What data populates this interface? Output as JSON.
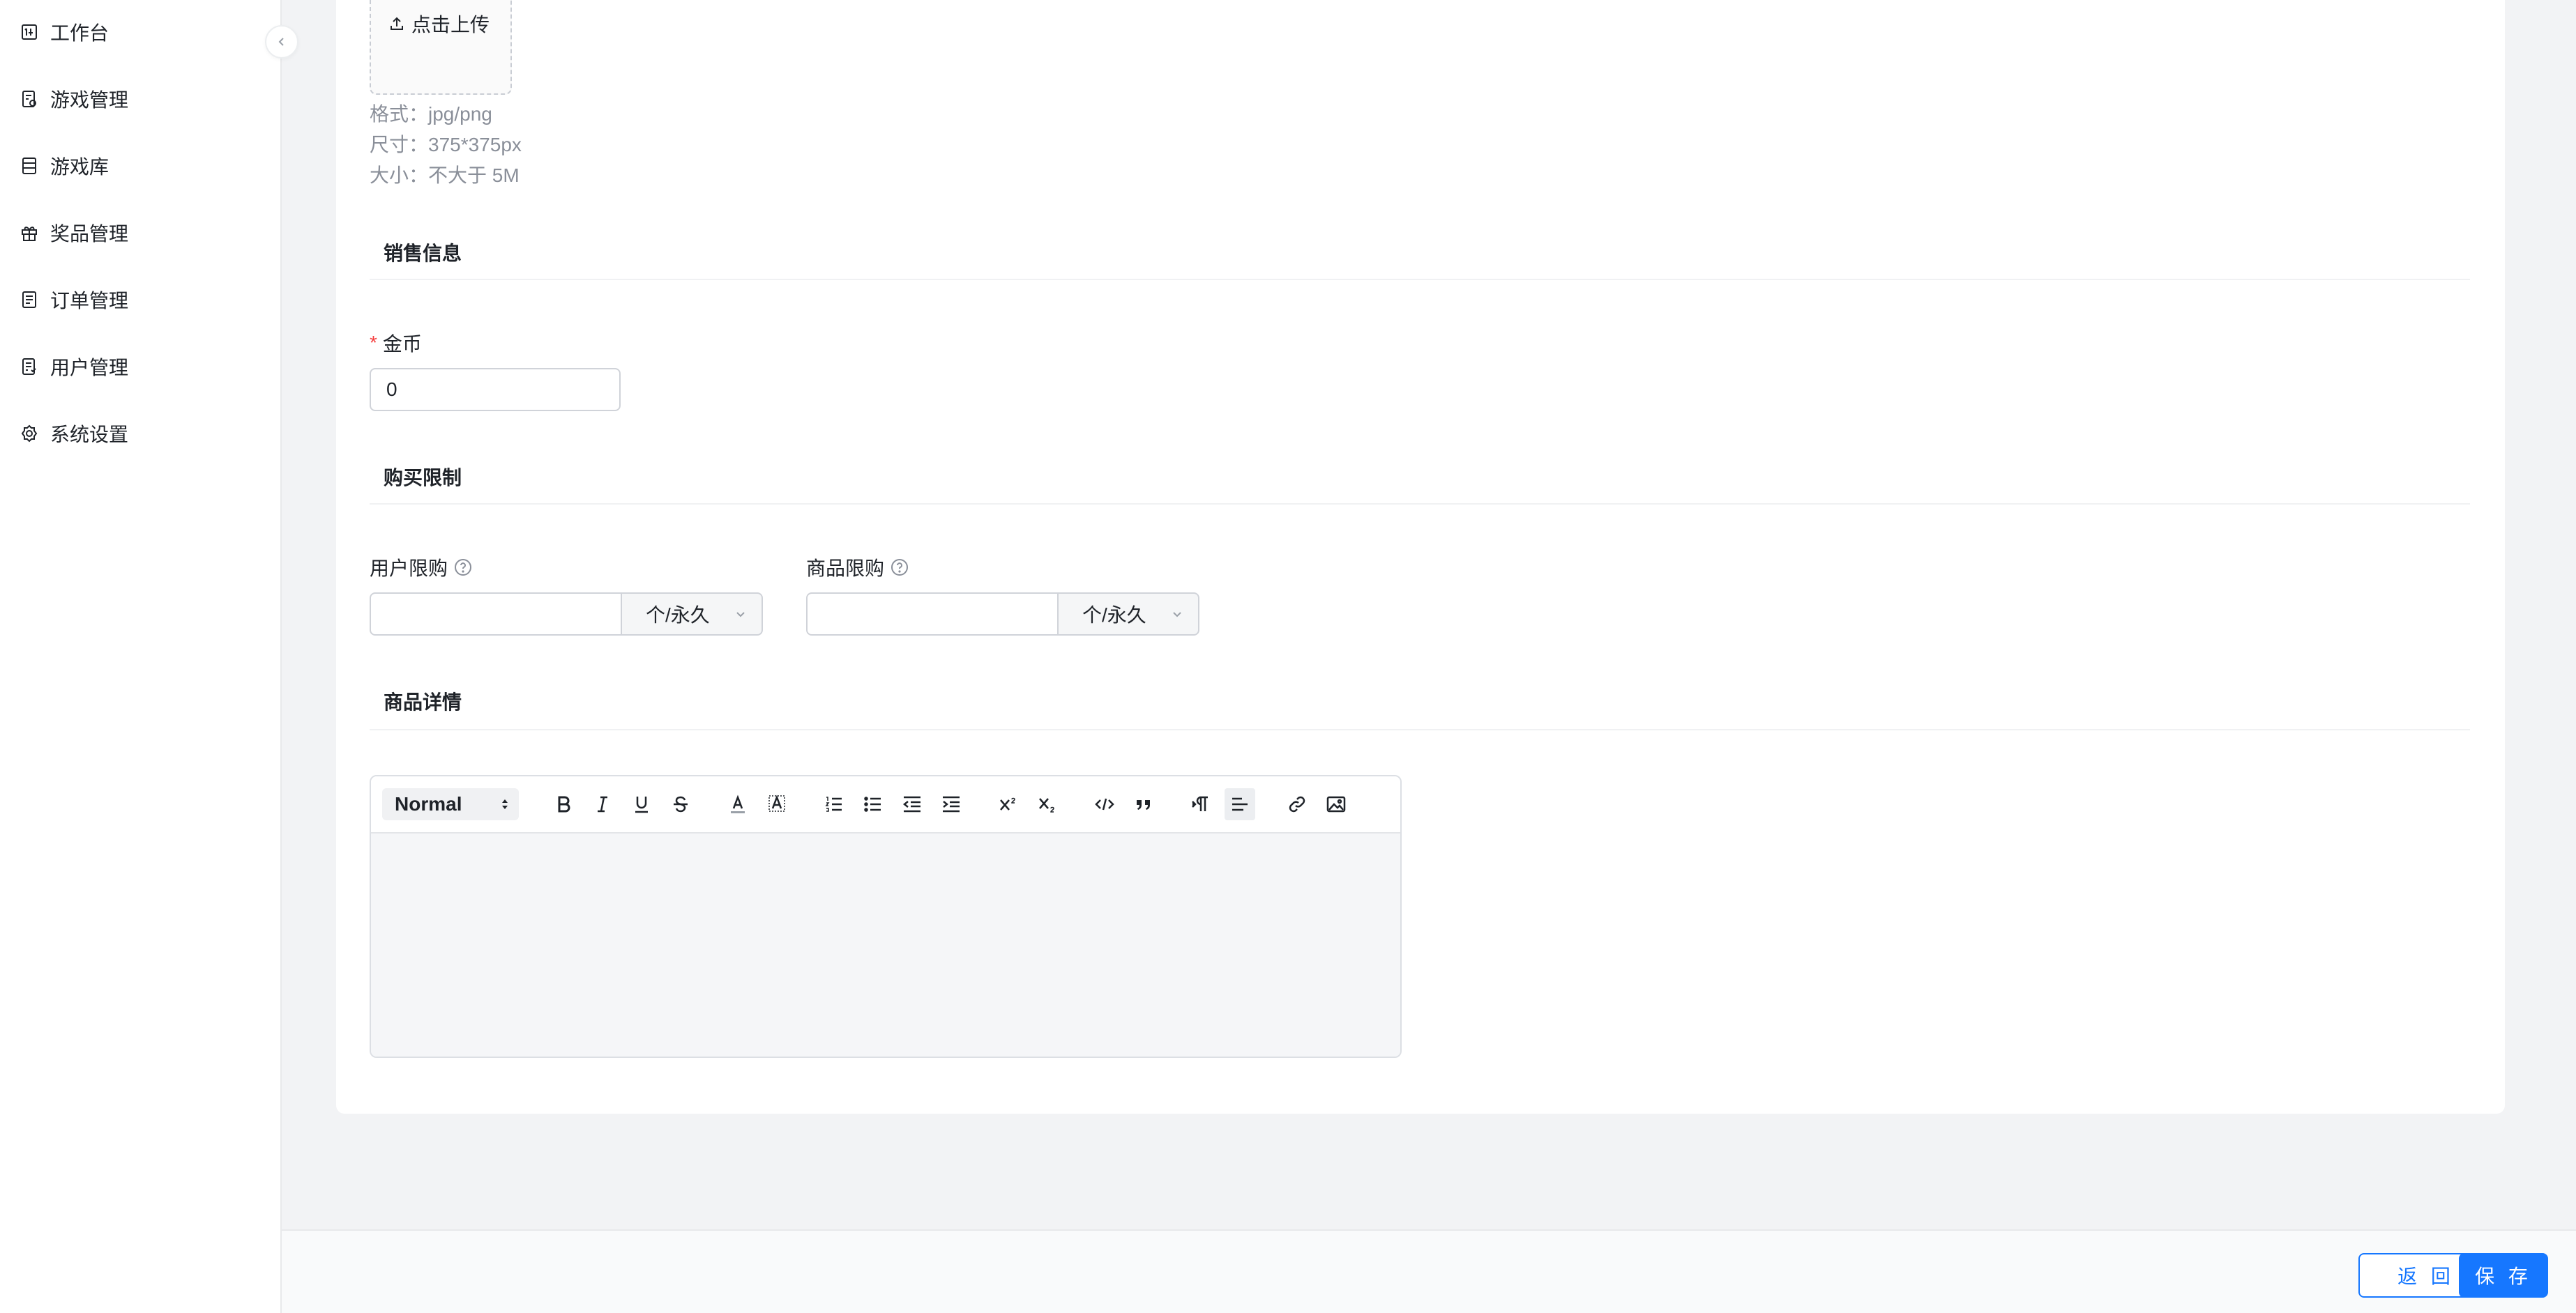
{
  "sidebar": {
    "items": [
      {
        "label": "工作台",
        "icon": "dashboard-icon"
      },
      {
        "label": "游戏管理",
        "icon": "game-doc-icon"
      },
      {
        "label": "游戏库",
        "icon": "library-icon"
      },
      {
        "label": "奖品管理",
        "icon": "gift-icon"
      },
      {
        "label": "订单管理",
        "icon": "order-icon"
      },
      {
        "label": "用户管理",
        "icon": "user-doc-icon"
      },
      {
        "label": "系统设置",
        "icon": "gear-icon"
      }
    ]
  },
  "upload": {
    "button_label": "点击上传",
    "hints": [
      "格式：jpg/png",
      "尺寸：375*375px",
      "大小：不大于 5M"
    ]
  },
  "sales": {
    "title": "销售信息",
    "coin_label": "金币",
    "coin_value": "0"
  },
  "limits": {
    "title": "购买限制",
    "user_limit_label": "用户限购",
    "user_limit_value": "",
    "user_limit_unit": "个/永久",
    "item_limit_label": "商品限购",
    "item_limit_value": "",
    "item_limit_unit": "个/永久"
  },
  "details": {
    "title": "商品详情",
    "format_select": "Normal"
  },
  "footer": {
    "back_label": "返 回",
    "save_label": "保 存"
  },
  "colors": {
    "primary": "#1677ff",
    "required": "#f53f3f"
  }
}
